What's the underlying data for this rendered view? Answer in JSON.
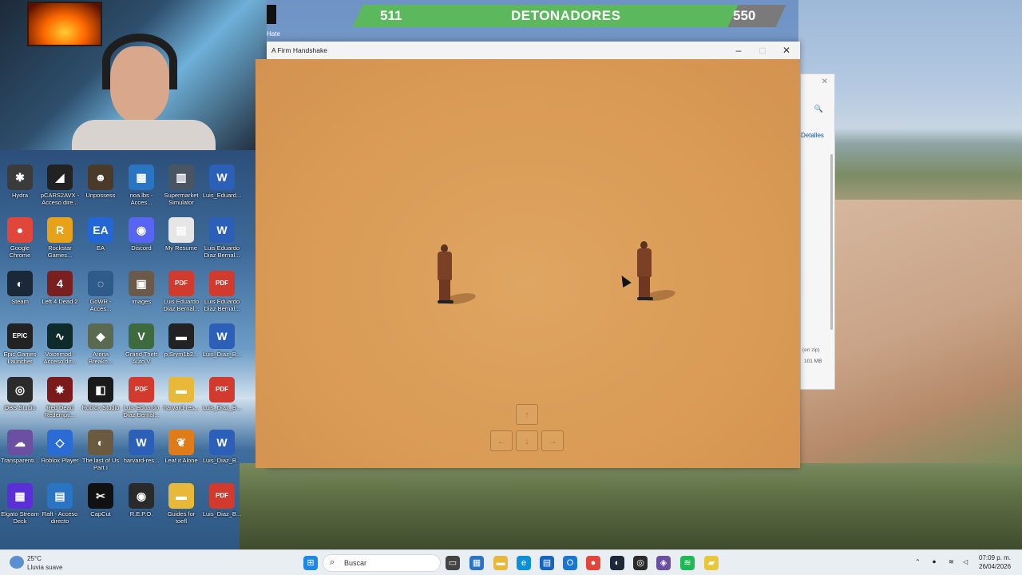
{
  "overlay": {
    "counter_left": "511",
    "counter_title": "DETONADORES",
    "counter_right": "550",
    "mini_label": "Hate"
  },
  "desktop": {
    "icons": [
      {
        "name": "Hydra",
        "glyph": "✱",
        "color": "#3b3b3b"
      },
      {
        "name": "pCARS2AVX - Acceso dire...",
        "glyph": "◢",
        "color": "#222"
      },
      {
        "name": "Unpossess",
        "glyph": "☻",
        "color": "#4a3a2a"
      },
      {
        "name": "noa.lbs - Acces...",
        "glyph": "▦",
        "color": "#2a74c4"
      },
      {
        "name": "Supermarket Simulator",
        "glyph": "▥",
        "color": "#4a5563"
      },
      {
        "name": "Luis_Eduard...",
        "glyph": "W",
        "color": "#2b5fb8"
      },
      {
        "name": "Google Chrome",
        "glyph": "●",
        "color": "#e0463a"
      },
      {
        "name": "Rockstar Games...",
        "glyph": "R",
        "color": "#e8a21a"
      },
      {
        "name": "EA",
        "glyph": "EA",
        "color": "#2367d6"
      },
      {
        "name": "Discord",
        "glyph": "◉",
        "color": "#5865f2"
      },
      {
        "name": "My Resume",
        "glyph": "▤",
        "color": "#e6e6e6"
      },
      {
        "name": "Luis Eduardo Diaz Bernal...",
        "glyph": "W",
        "color": "#2b5fb8"
      },
      {
        "name": "Steam",
        "glyph": "◐",
        "color": "#1b2838"
      },
      {
        "name": "Left 4 Dead 2",
        "glyph": "4",
        "color": "#7a1f1f"
      },
      {
        "name": "GoWR - Acces...",
        "glyph": "◌",
        "color": "#2f5b8a"
      },
      {
        "name": "images",
        "glyph": "▣",
        "color": "#6b5a4a"
      },
      {
        "name": "Luis Eduardo Diaz Bernal...",
        "glyph": "PDF",
        "color": "#d23a2e"
      },
      {
        "name": "Luis Eduardo Diaz Bernal...",
        "glyph": "PDF",
        "color": "#d23a2e"
      },
      {
        "name": "Epic Games Launcher",
        "glyph": "EPIC",
        "color": "#222"
      },
      {
        "name": "Voicemod - Acceso dir...",
        "glyph": "∿",
        "color": "#0f2a2a"
      },
      {
        "name": "Arena Breako...",
        "glyph": "◆",
        "color": "#5a6a50"
      },
      {
        "name": "Grand Theft Auto V",
        "glyph": "V",
        "color": "#3e6b3e"
      },
      {
        "name": "p.Srym1b2...",
        "glyph": "▬",
        "color": "#222"
      },
      {
        "name": "Luis_Diaz_B...",
        "glyph": "W",
        "color": "#2b5fb8"
      },
      {
        "name": "OBS Studio",
        "glyph": "◎",
        "color": "#2b2b2b"
      },
      {
        "name": "Red Dead Redempti...",
        "glyph": "✸",
        "color": "#7a1a1a"
      },
      {
        "name": "Roblox Studio",
        "glyph": "◧",
        "color": "#1a1a1a"
      },
      {
        "name": "Luis Eduardo Diaz Bernal...",
        "glyph": "PDF",
        "color": "#d23a2e"
      },
      {
        "name": "harvard-res...",
        "glyph": "▬",
        "color": "#e8b838"
      },
      {
        "name": "Luis_Diaz_B...",
        "glyph": "PDF",
        "color": "#d23a2e"
      },
      {
        "name": "Transparenti...",
        "glyph": "☁",
        "color": "#6b4fa0"
      },
      {
        "name": "Roblox Player",
        "glyph": "◇",
        "color": "#2b6bd6"
      },
      {
        "name": "The last of Us Part I",
        "glyph": "◐",
        "color": "#6a5a40"
      },
      {
        "name": "harvard-res...",
        "glyph": "W",
        "color": "#2b5fb8"
      },
      {
        "name": "Leaf it Alone",
        "glyph": "❦",
        "color": "#e07b1a"
      },
      {
        "name": "Luis_Diaz_B...",
        "glyph": "W",
        "color": "#2b5fb8"
      },
      {
        "name": "Elgato Stream Deck",
        "glyph": "▦",
        "color": "#5a2fd6"
      },
      {
        "name": "Raft - Acceso directo",
        "glyph": "▤",
        "color": "#2a74c4"
      },
      {
        "name": "CapCut",
        "glyph": "✂",
        "color": "#111"
      },
      {
        "name": "R.E.P.O.",
        "glyph": "◉",
        "color": "#2a2a2a"
      },
      {
        "name": "Guides for toefl",
        "glyph": "▬",
        "color": "#e8b838"
      },
      {
        "name": "Luis_Diaz_B...",
        "glyph": "PDF",
        "color": "#d23a2e"
      }
    ]
  },
  "game_window": {
    "title": "A Firm Handshake",
    "minimize": "–",
    "maximize": "□",
    "close": "✕",
    "keys": {
      "up": "↑",
      "left": "←",
      "down": "↓",
      "right": "→"
    }
  },
  "explorer": {
    "close": "✕",
    "search": "🔍",
    "details": "Detalles",
    "zip_label": "(en zip)",
    "size": "101 MB"
  },
  "taskbar": {
    "weather_temp": "25°C",
    "weather_desc": "Lluvia suave",
    "search_placeholder": "Buscar",
    "time": "07:09 p. m.",
    "date": "26/04/2026"
  }
}
